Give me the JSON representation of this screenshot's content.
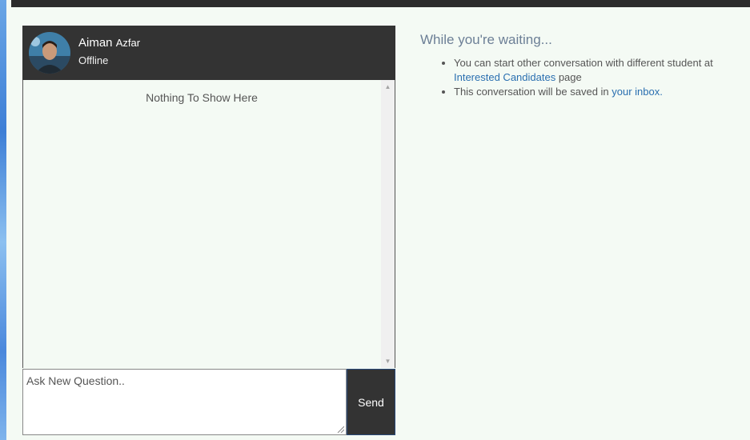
{
  "chat": {
    "user_first_name": "Aiman",
    "user_last_name": "Azfar",
    "status": "Offline",
    "empty_message": "Nothing To Show Here",
    "input_placeholder": "Ask New Question..",
    "send_label": "Send"
  },
  "info": {
    "title": "While you're waiting...",
    "items": [
      {
        "text_before": "You can start other conversation with different student at ",
        "link": "Interested Candidates",
        "text_after": " page"
      },
      {
        "text_before": "This conversation will be saved in ",
        "link": "your inbox.",
        "text_after": ""
      }
    ]
  },
  "colors": {
    "header_bg": "#333333",
    "panel_bg": "#f4faf4",
    "link": "#2a6fb0",
    "title": "#6c7f96"
  }
}
